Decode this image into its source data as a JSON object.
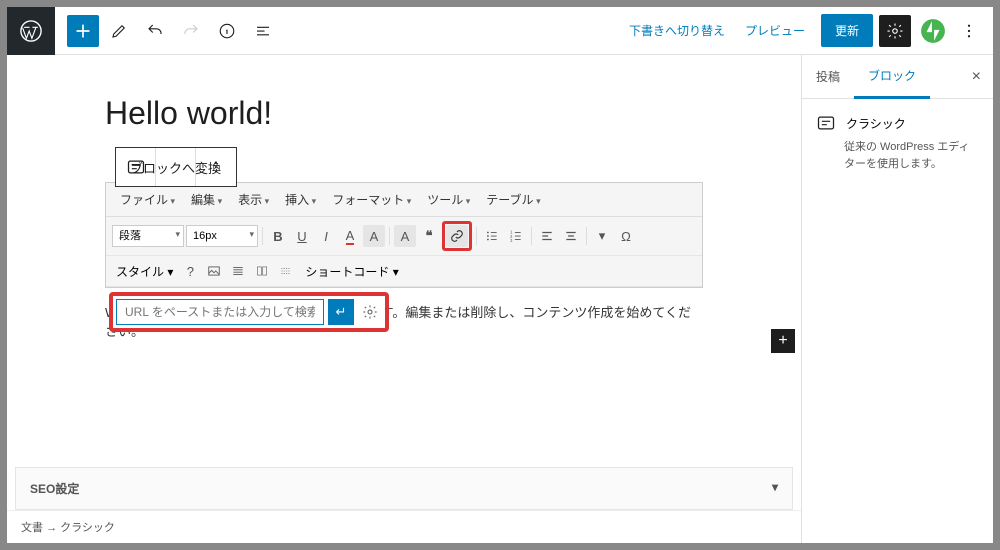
{
  "topbar": {
    "draft_switch": "下書きへ切り替え",
    "preview": "プレビュー",
    "update": "更新"
  },
  "title": "Hello world!",
  "float_toolbar": {
    "convert": "ブロックへ変換"
  },
  "classic_menu": {
    "file": "ファイル",
    "edit": "編集",
    "view": "表示",
    "insert": "挿入",
    "format": "フォーマット",
    "tools": "ツール",
    "table": "テーブル"
  },
  "classic_row1": {
    "para": "段落",
    "size": "16px"
  },
  "classic_row2": {
    "style": "スタイル",
    "shortcode": "ショートコード"
  },
  "content_text": "WordPress へようこそ。こちらは最初の投稿です。編集または削除し、コンテンツ作成を始めてください。",
  "url_popup": {
    "placeholder": "URL をペーストまたは入力して検索"
  },
  "seo": {
    "label": "SEO設定"
  },
  "breadcrumb": {
    "doc": "文書",
    "sep": "→",
    "block": "クラシック"
  },
  "sidebar": {
    "tab_post": "投稿",
    "tab_block": "ブロック",
    "block_name": "クラシック",
    "block_desc": "従来の WordPress エディターを使用します。"
  }
}
